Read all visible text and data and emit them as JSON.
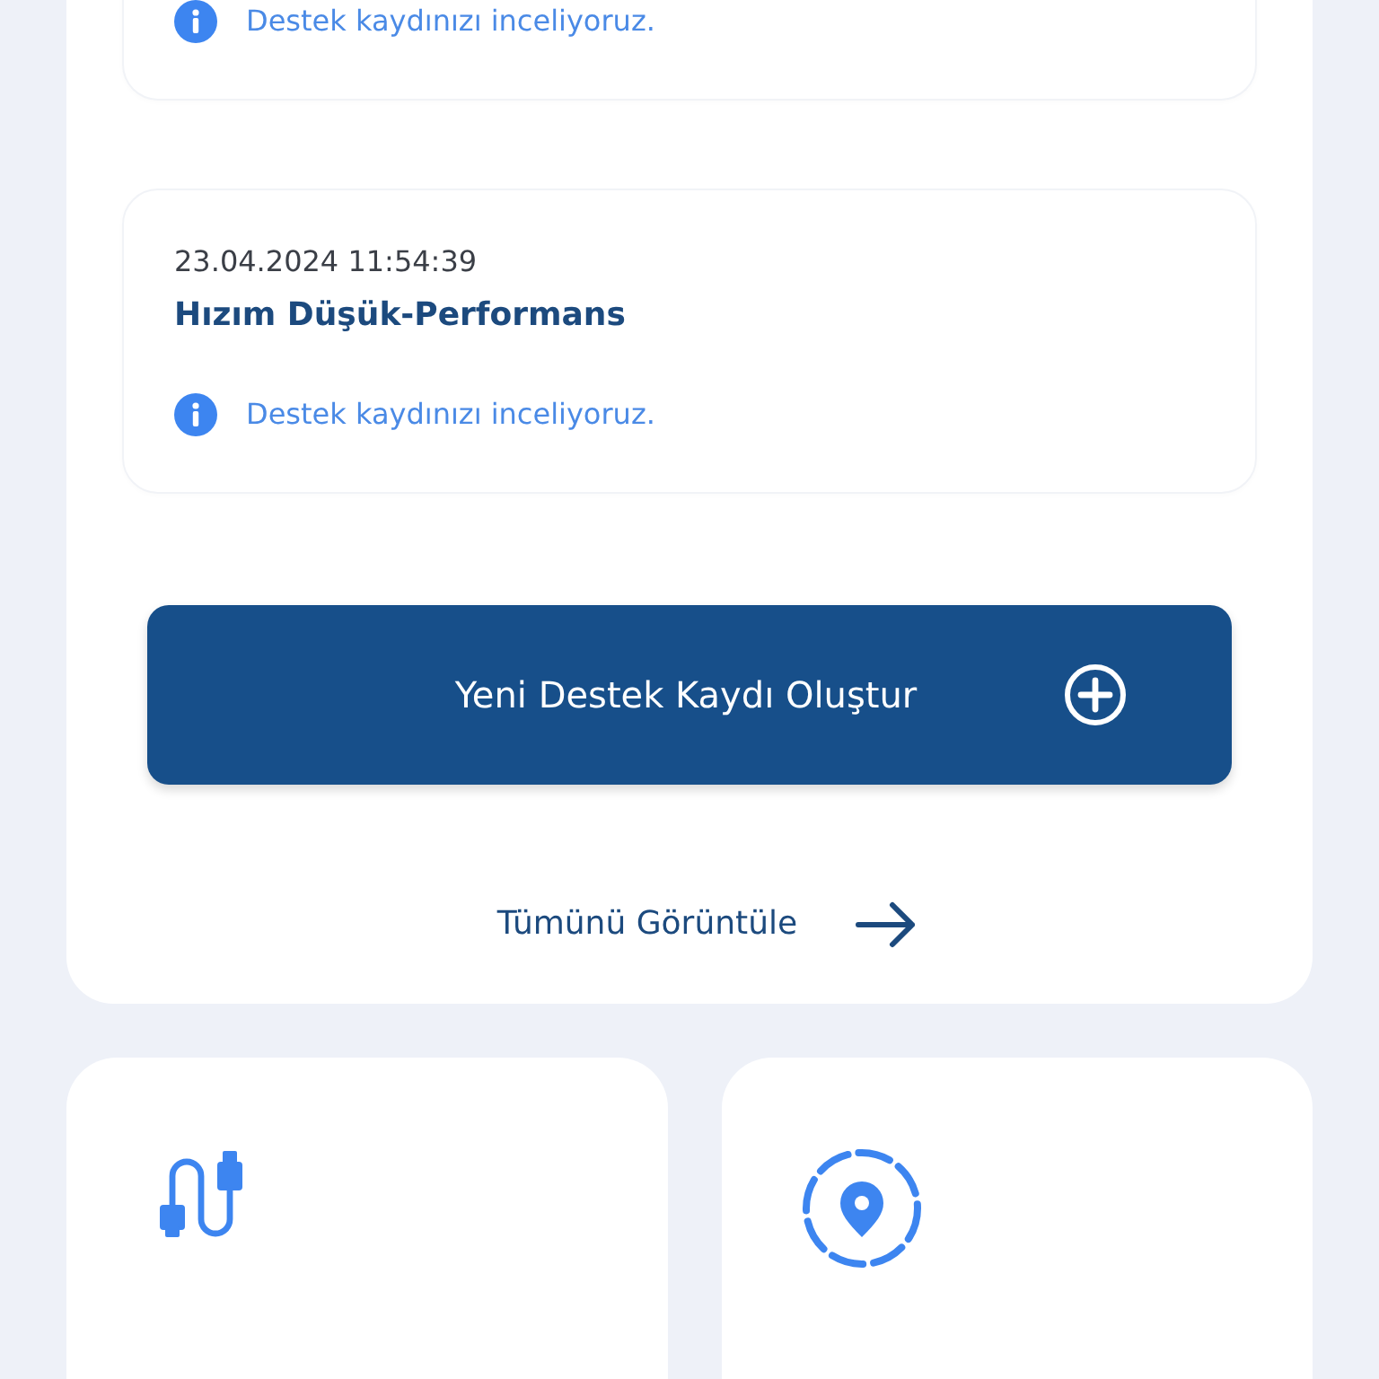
{
  "tickets": [
    {
      "status": "Destek kaydınızı inceliyoruz."
    },
    {
      "date": "23.04.2024 11:54:39",
      "title": "Hızım Düşük-Performans",
      "status": "Destek kaydınızı inceliyoruz."
    }
  ],
  "new_ticket_button": {
    "label": "Yeni Destek Kaydı Oluştur"
  },
  "view_all_link": {
    "label": "Tümünü Görüntüle"
  },
  "tiles": [
    {
      "kind": "cable"
    },
    {
      "kind": "location"
    }
  ]
}
